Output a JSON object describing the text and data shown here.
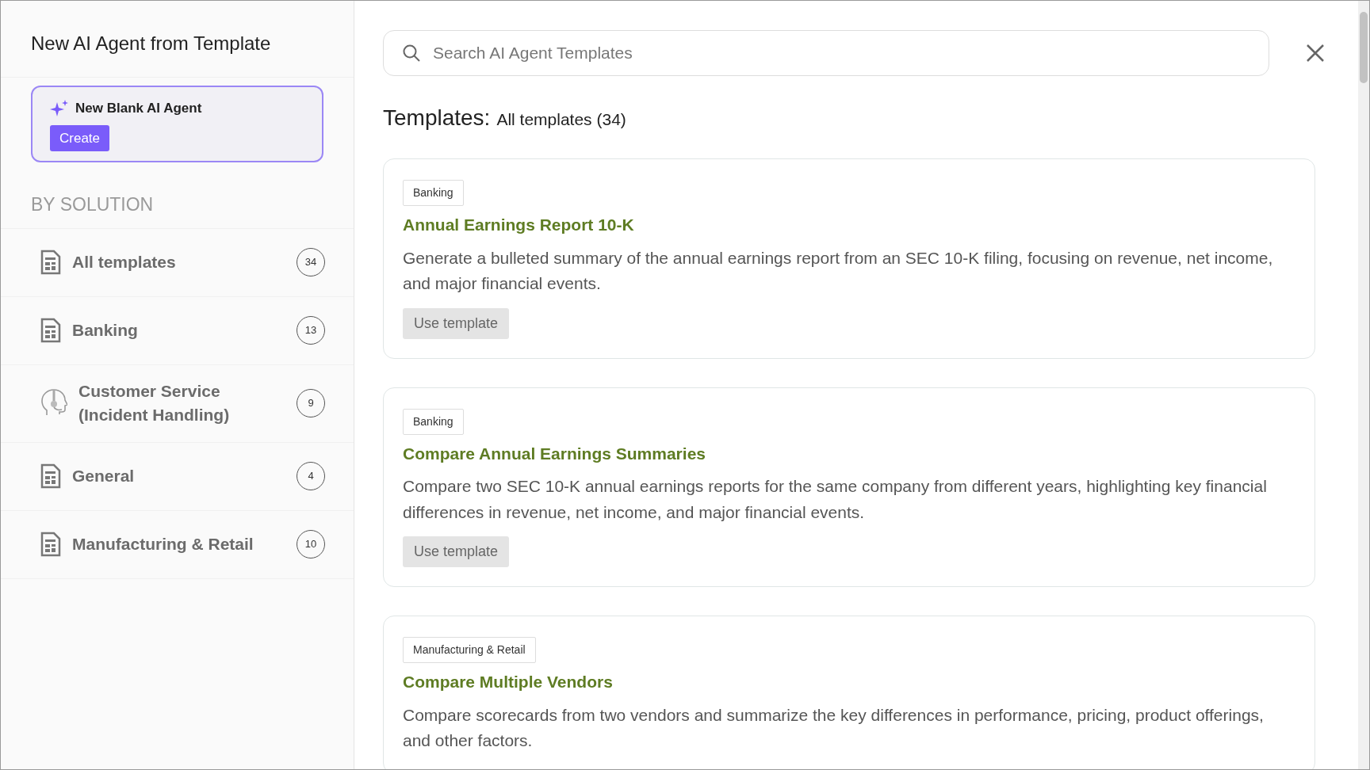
{
  "sidebar": {
    "title": "New AI Agent from Template",
    "blank_agent": {
      "label": "New Blank AI Agent",
      "button": "Create"
    },
    "section_heading": "BY SOLUTION",
    "items": [
      {
        "kind": "document",
        "label": "All templates",
        "count": "34"
      },
      {
        "kind": "document",
        "label": "Banking",
        "count": "13"
      },
      {
        "kind": "headset",
        "label": "Customer Service (Incident Handling)",
        "count": "9"
      },
      {
        "kind": "document",
        "label": "General",
        "count": "4"
      },
      {
        "kind": "document",
        "label": "Manufacturing & Retail",
        "count": "10"
      }
    ]
  },
  "search": {
    "placeholder": "Search AI Agent Templates"
  },
  "heading": {
    "title": "Templates:",
    "filter": "All templates (34)"
  },
  "templates": [
    {
      "tag": "Banking",
      "title": "Annual Earnings Report 10-K",
      "description": "Generate a bulleted summary of the annual earnings report from an SEC 10-K filing, focusing on revenue, net income, and major financial events.",
      "button": "Use template"
    },
    {
      "tag": "Banking",
      "title": "Compare Annual Earnings Summaries",
      "description": "Compare two SEC 10-K annual earnings reports for the same company from different years, highlighting key financial differences in revenue, net income, and major financial events.",
      "button": "Use template"
    },
    {
      "tag": "Manufacturing & Retail",
      "title": "Compare Multiple Vendors",
      "description": "Compare scorecards from two vendors and summarize the key differences in performance, pricing, product offerings, and other factors."
    }
  ]
}
